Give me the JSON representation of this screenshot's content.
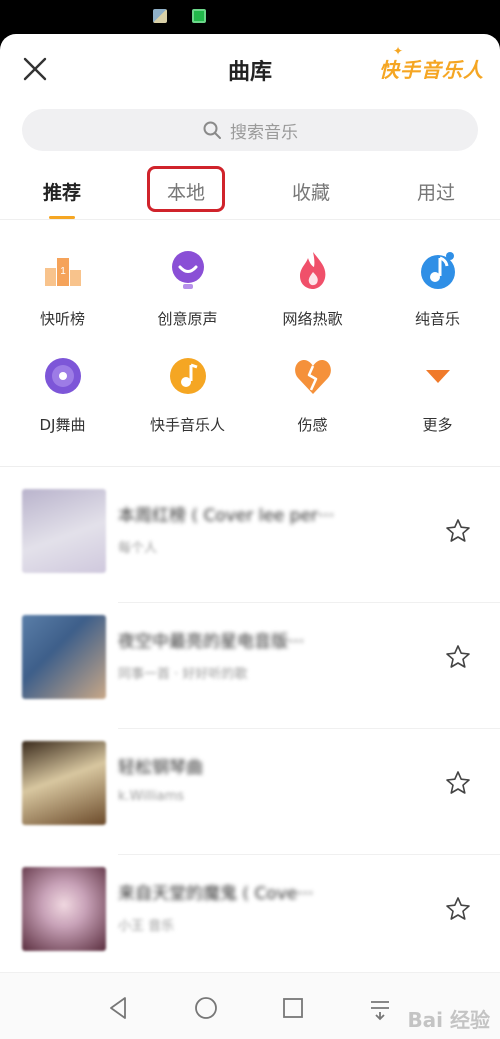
{
  "header": {
    "title": "曲库",
    "brand": "快手音乐人"
  },
  "search": {
    "placeholder": "搜索音乐"
  },
  "tabs": [
    {
      "label": "推荐",
      "active": true
    },
    {
      "label": "本地",
      "active": false
    },
    {
      "label": "收藏",
      "active": false
    },
    {
      "label": "用过",
      "active": false
    }
  ],
  "categories": [
    {
      "label": "快听榜",
      "icon": "podium-icon",
      "color": "#f5a35a"
    },
    {
      "label": "创意原声",
      "icon": "microphone-icon",
      "color": "#8a4fd6"
    },
    {
      "label": "网络热歌",
      "icon": "flame-icon",
      "color": "#f0506a"
    },
    {
      "label": "纯音乐",
      "icon": "music-note-circle-icon",
      "color": "#2f8fe6"
    },
    {
      "label": "DJ舞曲",
      "icon": "vinyl-disc-icon",
      "color": "#7d56d8"
    },
    {
      "label": "快手音乐人",
      "icon": "music-note-orange-icon",
      "color": "#f5a623"
    },
    {
      "label": "伤感",
      "icon": "broken-heart-icon",
      "color": "#f5913a"
    },
    {
      "label": "更多",
      "icon": "triangle-down-icon",
      "color": "#f07a2a"
    }
  ],
  "songs": [
    {
      "title": "本周红榜 ( Cover lee per···",
      "artist": "每个人",
      "cover": [
        "#b9b3cc",
        "#e3e1ea"
      ]
    },
    {
      "title": "夜空中最亮的星电音版···",
      "artist": "同事一首 · 好好听的歌",
      "cover": [
        "#3e5f8a",
        "#c9a888"
      ]
    },
    {
      "title": "轻松钢琴曲",
      "artist": "k.Williams",
      "cover": [
        "#3a2a1c",
        "#d8c7a0"
      ]
    },
    {
      "title": "来自天堂的魔鬼 ( Cove···",
      "artist": "小王 音乐",
      "cover": [
        "#c8a2b8",
        "#5a2e3e"
      ]
    }
  ],
  "navbar": {
    "watermark": "Bai 经验"
  }
}
